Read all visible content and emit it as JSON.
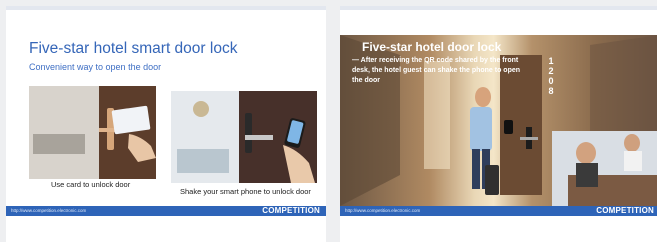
{
  "slide1": {
    "title": "Five-star hotel smart door lock",
    "subtitle": "Convenient way to open the door",
    "caption_card": "Use card to unlock door",
    "caption_phone": "Shake your smart phone to unlock door",
    "footer_url": "http://www.competition.electronic.com",
    "footer_brand": "COMPETITION"
  },
  "slide2": {
    "title": "Five-star hotel door lock",
    "body": "— After receiving the QR code shared by the front desk, the hotel guest can shake the phone to open the door",
    "room_number": [
      "1",
      "2",
      "0",
      "8"
    ],
    "footer_url": "http://www.competition.electronic.com",
    "footer_brand": "COMPETITION"
  },
  "colors": {
    "accent": "#2e64b8",
    "title": "#3566b8",
    "background": "#eeeff1"
  }
}
